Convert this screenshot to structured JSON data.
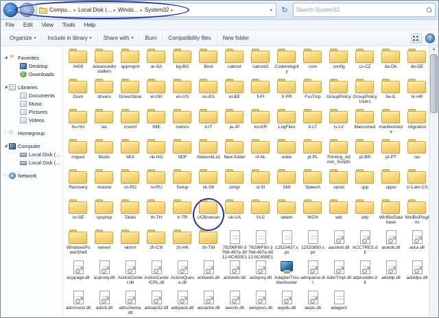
{
  "chrome": {
    "breadcrumb": {
      "segments": [
        "Compu...",
        "Local Disk (...",
        "Windo...",
        "System32"
      ]
    },
    "search": {
      "placeholder": "Search System32"
    },
    "menu": [
      "File",
      "Edit",
      "View",
      "Tools",
      "Help"
    ],
    "toolbar": [
      {
        "label": "Organize",
        "dd": true
      },
      {
        "label": "Include in library",
        "dd": true
      },
      {
        "label": "Share with",
        "dd": true
      },
      {
        "label": "Burn",
        "dd": false
      },
      {
        "label": "Compatibility files",
        "dd": false
      },
      {
        "label": "New folder",
        "dd": false
      }
    ],
    "toolbar_right_icons": [
      "views-icon",
      "help-icon"
    ],
    "nav_icons": [
      "back-arrow-icon",
      "forward-arrow-icon",
      "refresh-icon",
      "search-icon",
      "breadcrumb-separator-icon",
      "dropdown-arrow-icon"
    ]
  },
  "sidebar": {
    "items": [
      {
        "label": "Favorites",
        "kind": "section",
        "icon": "star",
        "expander": "expanded"
      },
      {
        "label": "Desktop",
        "kind": "child",
        "icon": "desktop"
      },
      {
        "label": "Downloads",
        "kind": "child",
        "icon": "downloads"
      },
      {
        "label": "Libraries",
        "kind": "section",
        "icon": "libraries",
        "expander": "expanded"
      },
      {
        "label": "Documents",
        "kind": "child",
        "icon": "documents"
      },
      {
        "label": "Music",
        "kind": "child",
        "icon": "music"
      },
      {
        "label": "Pictures",
        "kind": "child",
        "icon": "pictures"
      },
      {
        "label": "Videos",
        "kind": "child",
        "icon": "videos"
      },
      {
        "label": "Homegroup",
        "kind": "section",
        "icon": "homegroup",
        "expander": "collapsed"
      },
      {
        "label": "Computer",
        "kind": "section",
        "icon": "computer",
        "expander": "expanded"
      },
      {
        "label": "Local Disk (C:)",
        "kind": "child",
        "icon": "disk"
      },
      {
        "label": "Local Disk (D:)",
        "kind": "child",
        "icon": "disk"
      },
      {
        "label": "Network",
        "kind": "section",
        "icon": "network",
        "expander": "collapsed"
      }
    ]
  },
  "files": {
    "items": [
      {
        "label": "0409",
        "type": "folder"
      },
      {
        "label": "AdvancedInstallers",
        "type": "folder"
      },
      {
        "label": "appmgmt",
        "type": "folder"
      },
      {
        "label": "ar-SA",
        "type": "folder"
      },
      {
        "label": "bg-BG",
        "type": "folder"
      },
      {
        "label": "Boot",
        "type": "folder"
      },
      {
        "label": "catroot",
        "type": "folder"
      },
      {
        "label": "catroot2",
        "type": "folder"
      },
      {
        "label": "CodeIntegrity",
        "type": "folder"
      },
      {
        "label": "com",
        "type": "folder"
      },
      {
        "label": "config",
        "type": "folder"
      },
      {
        "label": "cs-CZ",
        "type": "folder"
      },
      {
        "label": "da-DK",
        "type": "folder"
      },
      {
        "label": "de-DE",
        "type": "folder"
      },
      {
        "label": "Dism",
        "type": "folder"
      },
      {
        "label": "drivers",
        "type": "folder"
      },
      {
        "label": "DriverStore",
        "type": "folder"
      },
      {
        "label": "el-GR",
        "type": "folder"
      },
      {
        "label": "en-US",
        "type": "folder"
      },
      {
        "label": "es-ES",
        "type": "folder"
      },
      {
        "label": "et-EE",
        "type": "folder"
      },
      {
        "label": "fi-FI",
        "type": "folder"
      },
      {
        "label": "fr-FR",
        "type": "folder"
      },
      {
        "label": "FxsTmp",
        "type": "folder"
      },
      {
        "label": "GroupPolicy",
        "type": "folder"
      },
      {
        "label": "GroupPolicyUsers",
        "type": "folder"
      },
      {
        "label": "he-IL",
        "type": "folder"
      },
      {
        "label": "hr-HR",
        "type": "folder"
      },
      {
        "label": "hu-HU",
        "type": "folder"
      },
      {
        "label": "ias",
        "type": "folder"
      },
      {
        "label": "icsxml",
        "type": "folder"
      },
      {
        "label": "IME",
        "type": "folder"
      },
      {
        "label": "inetsrv",
        "type": "folder"
      },
      {
        "label": "it-IT",
        "type": "folder"
      },
      {
        "label": "ja-JP",
        "type": "folder"
      },
      {
        "label": "ko-KR",
        "type": "folder"
      },
      {
        "label": "LogFiles",
        "type": "folder"
      },
      {
        "label": "lt-LT",
        "type": "folder"
      },
      {
        "label": "lv-LV",
        "type": "folder"
      },
      {
        "label": "Macromed",
        "type": "folder"
      },
      {
        "label": "manifeststore",
        "type": "folder"
      },
      {
        "label": "migration",
        "type": "folder"
      },
      {
        "label": "migwiz",
        "type": "folder"
      },
      {
        "label": "Msdtc",
        "type": "folder"
      },
      {
        "label": "MUI",
        "type": "folder"
      },
      {
        "label": "nb-NO",
        "type": "folder"
      },
      {
        "label": "NDF",
        "type": "folder"
      },
      {
        "label": "NetworkList",
        "type": "folder"
      },
      {
        "label": "New folder",
        "type": "folder"
      },
      {
        "label": "nl-NL",
        "type": "folder"
      },
      {
        "label": "oobe",
        "type": "folder"
      },
      {
        "label": "pl-PL",
        "type": "folder"
      },
      {
        "label": "Printing_Admin_Scripts",
        "type": "folder"
      },
      {
        "label": "pt-BR",
        "type": "folder"
      },
      {
        "label": "pt-PT",
        "type": "folder"
      },
      {
        "label": "ras",
        "type": "folder"
      },
      {
        "label": "Recovery",
        "type": "folder"
      },
      {
        "label": "restore",
        "type": "folder"
      },
      {
        "label": "ro-RO",
        "type": "folder"
      },
      {
        "label": "ru-RU",
        "type": "folder"
      },
      {
        "label": "Setup",
        "type": "folder"
      },
      {
        "label": "sk-SK",
        "type": "folder"
      },
      {
        "label": "slmgr",
        "type": "folder"
      },
      {
        "label": "sl-SI",
        "type": "folder"
      },
      {
        "label": "SMI",
        "type": "folder"
      },
      {
        "label": "Speech",
        "type": "folder"
      },
      {
        "label": "spool",
        "type": "folder"
      },
      {
        "label": "spp",
        "type": "folder"
      },
      {
        "label": "sppui",
        "type": "folder"
      },
      {
        "label": "sr-Latn-CS",
        "type": "folder"
      },
      {
        "label": "sv-SE",
        "type": "folder"
      },
      {
        "label": "sysprep",
        "type": "folder"
      },
      {
        "label": "Tasks",
        "type": "folder"
      },
      {
        "label": "th-TH",
        "type": "folder"
      },
      {
        "label": "tr-TR",
        "type": "folder"
      },
      {
        "label": "UCBrowser",
        "type": "folder"
      },
      {
        "label": "uk-UA",
        "type": "folder"
      },
      {
        "label": "VLC",
        "type": "folder"
      },
      {
        "label": "wbem",
        "type": "folder"
      },
      {
        "label": "WCN",
        "type": "folder"
      },
      {
        "label": "wdi",
        "type": "folder"
      },
      {
        "label": "wfp",
        "type": "folder"
      },
      {
        "label": "WinBioDatabase",
        "type": "folder"
      },
      {
        "label": "WinBioPlugIns",
        "type": "folder"
      },
      {
        "label": "WindowsPowerShell",
        "type": "folder"
      },
      {
        "label": "winevt",
        "type": "folder"
      },
      {
        "label": "winrm",
        "type": "folder"
      },
      {
        "label": "zh-CN",
        "type": "folder"
      },
      {
        "label": "zh-HK",
        "type": "folder"
      },
      {
        "label": "zh-TW",
        "type": "folder"
      },
      {
        "label": "78296F80-3768-497e-8012-9C450E1B7327-5...",
        "type": "doc"
      },
      {
        "label": "78296F80-3768-497e-8012-9C450E1B7327-5...",
        "type": "doc"
      },
      {
        "label": "12520437.cpx",
        "type": "doc"
      },
      {
        "label": "12520850.cpx",
        "type": "doc"
      },
      {
        "label": "aaclient.dll",
        "type": "dll"
      },
      {
        "label": "ACCTRES.dll",
        "type": "dll"
      },
      {
        "label": "acledit.dll",
        "type": "dll"
      },
      {
        "label": "aclui.dll",
        "type": "dll"
      },
      {
        "label": "acppage.dll",
        "type": "dll"
      },
      {
        "label": "acproxy.dll",
        "type": "dll"
      },
      {
        "label": "ActionCenter.dll",
        "type": "dll"
      },
      {
        "label": "ActionCenterCPL.dll",
        "type": "dll"
      },
      {
        "label": "ActionQueue.dll",
        "type": "dll"
      },
      {
        "label": "activeds.dll",
        "type": "dll"
      },
      {
        "label": "activeds.tlb",
        "type": "dll"
      },
      {
        "label": "actxprxy.dll",
        "type": "dll"
      },
      {
        "label": "AdapterTroubleshooter",
        "type": "app"
      },
      {
        "label": "admparse.dll",
        "type": "dll"
      },
      {
        "label": "AdmTmpl.dll",
        "type": "dll"
      },
      {
        "label": "adprovider.dll",
        "type": "dll"
      },
      {
        "label": "adsldp.dll",
        "type": "dll"
      },
      {
        "label": "adsldpc.dll",
        "type": "dll"
      },
      {
        "label": "adsmsext.dll",
        "type": "dll"
      },
      {
        "label": "adsnt.dll",
        "type": "dll"
      },
      {
        "label": "adtschema.dll",
        "type": "dll"
      },
      {
        "label": "advapi32.dll",
        "type": "dll"
      },
      {
        "label": "advpack.dll",
        "type": "dll"
      },
      {
        "label": "aecache.dll",
        "type": "dll"
      },
      {
        "label": "aeevts.dll",
        "type": "dll"
      },
      {
        "label": "aelupsvc.dll",
        "type": "dll"
      },
      {
        "label": "aepdu.dll",
        "type": "dll"
      },
      {
        "label": "aepic.dll",
        "type": "dll"
      },
      {
        "label": "aitagent",
        "type": "doc"
      }
    ]
  },
  "annotations": {
    "color": "#2431bd",
    "breadcrumb_circled": true,
    "circled_item_label": "UCBrowser"
  }
}
